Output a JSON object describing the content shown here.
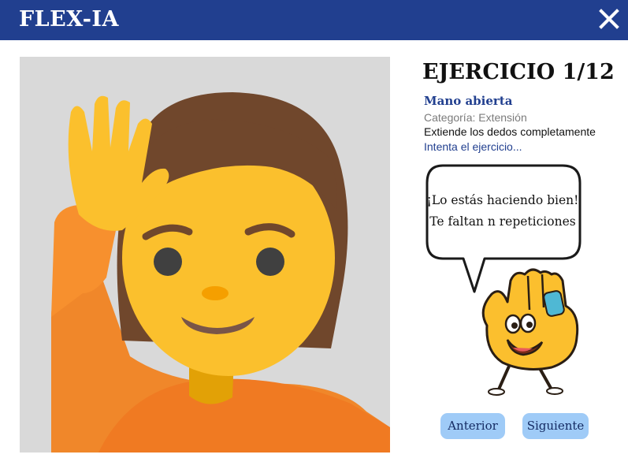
{
  "header": {
    "app_title": "FLEX-IA",
    "close_icon": "close-icon"
  },
  "colors": {
    "header_bg": "#213f8f",
    "accent_text": "#213f8f",
    "button_bg": "#9fcbf7",
    "camera_bg": "#d9d9d9"
  },
  "camera": {
    "content_icon": "person-raising-hand-emoji"
  },
  "exercise": {
    "title": "EJERCICIO 1/12",
    "name": "Mano abierta",
    "category": "Categoría: Extensión",
    "description": "Extiende los dedos completamente",
    "prompt": "Intenta el ejercicio..."
  },
  "feedback": {
    "line1": "¡Lo estás haciendo bien!",
    "line2": "Te faltan n repeticiones",
    "mascot_icon": "hand-mascot-icon"
  },
  "navigation": {
    "prev_label": "Anterior",
    "next_label": "Siguiente"
  }
}
